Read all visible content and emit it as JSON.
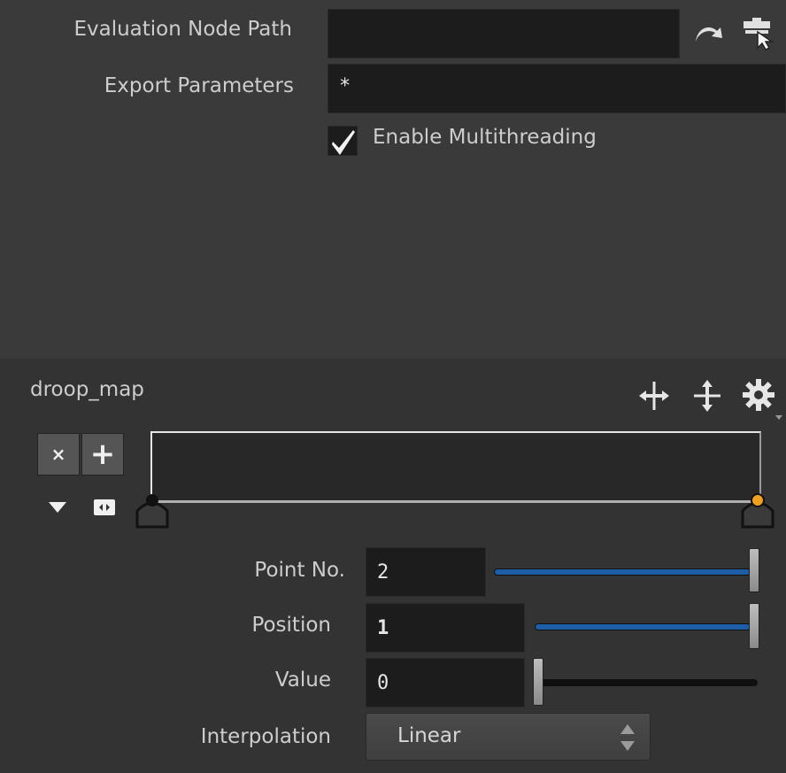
{
  "params": {
    "evaluation_node_path": {
      "label": "Evaluation Node Path",
      "value": ""
    },
    "export_parameters": {
      "label": "Export Parameters",
      "value": "*"
    },
    "multithreading": {
      "label": "Enable Multithreading",
      "checked": true
    }
  },
  "ramp": {
    "name": "droop_map",
    "delete_label": "×",
    "add_label": "+",
    "point_no": {
      "label": "Point No.",
      "value": "2",
      "fill": 1.0
    },
    "position": {
      "label": "Position",
      "value": "1",
      "fill": 1.0
    },
    "value": {
      "label": "Value",
      "value": "0",
      "fill": 0.0
    },
    "interpolation": {
      "label": "Interpolation",
      "value": "Linear"
    }
  },
  "colors": {
    "accent": "#1e5da8",
    "selected_key": "#f0a020",
    "panel": "#3a3a3a"
  },
  "icons": [
    "jump-arrow-icon",
    "node-chooser-icon",
    "checkmark-icon",
    "move-horizontal-icon",
    "move-vertical-icon",
    "gear-icon",
    "triangle-down-icon",
    "toggle-icon",
    "key-marker-icon",
    "spinner-arrows-icon"
  ]
}
